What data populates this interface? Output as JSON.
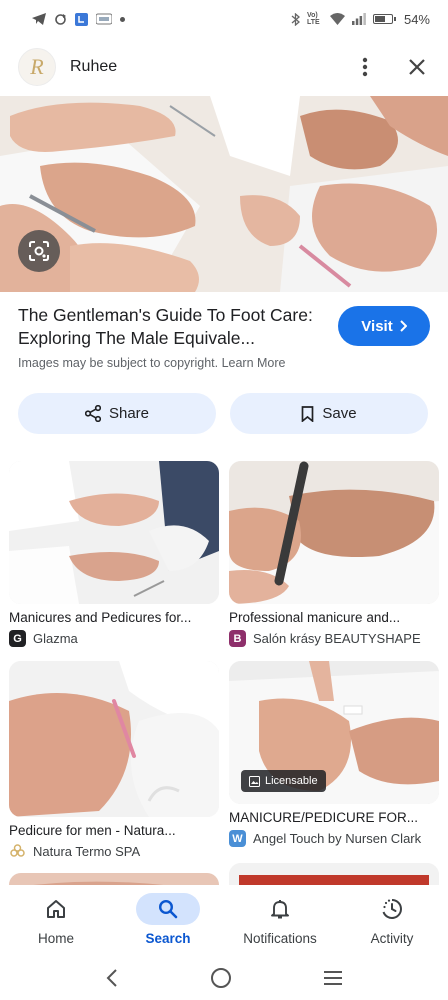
{
  "status_bar": {
    "battery_percent": "54%",
    "battery_level": 0.54,
    "network_label": "Vo) LTE",
    "icons": [
      "telegram-icon",
      "sync-icon",
      "app-icon",
      "notification-dot-icon",
      "bluetooth-icon",
      "wifi-icon",
      "signal-icon",
      "battery-icon"
    ]
  },
  "header": {
    "avatar_letter": "R",
    "account_name": "Ruhee",
    "icons": [
      "more-vert-icon",
      "close-icon"
    ]
  },
  "hero": {
    "lens_icon": "lens-icon"
  },
  "result": {
    "title": "The Gentleman's Guide To Foot Care: Exploring The Male Equivale...",
    "visit_label": "Visit",
    "copyright_text": "Images may be subject to copyright. Learn More"
  },
  "actions": {
    "share_label": "Share",
    "save_label": "Save"
  },
  "related": [
    {
      "title": "Manicures and Pedicures for...",
      "source": "Glazma",
      "favicon_letter": "G",
      "favicon_color": "#202124"
    },
    {
      "title": "Professional manicure and...",
      "source": "Salón krásy BEAUTYSHAPE",
      "favicon_letter": "B",
      "favicon_color": "#8e2f6b"
    },
    {
      "title": "Pedicure for men - Natura...",
      "source": "Natura Termo SPA",
      "favicon_letter": "",
      "favicon_color": "#d4b26a"
    },
    {
      "title": "MANICURE/PEDICURE FOR...",
      "source": "Angel Touch by Nursen Clark",
      "favicon_letter": "W",
      "favicon_color": "#4a8fd6",
      "badge": "Licensable"
    }
  ],
  "bottom_nav": [
    {
      "label": "Home",
      "icon": "home-icon",
      "active": false
    },
    {
      "label": "Search",
      "icon": "search-icon",
      "active": true
    },
    {
      "label": "Notifications",
      "icon": "bell-icon",
      "active": false
    },
    {
      "label": "Activity",
      "icon": "activity-icon",
      "active": false
    }
  ],
  "colors": {
    "accent": "#1a73e8",
    "pill_bg": "#e8f0fe",
    "nav_active_bg": "#d3e3fd",
    "nav_active_text": "#0b57d0"
  }
}
